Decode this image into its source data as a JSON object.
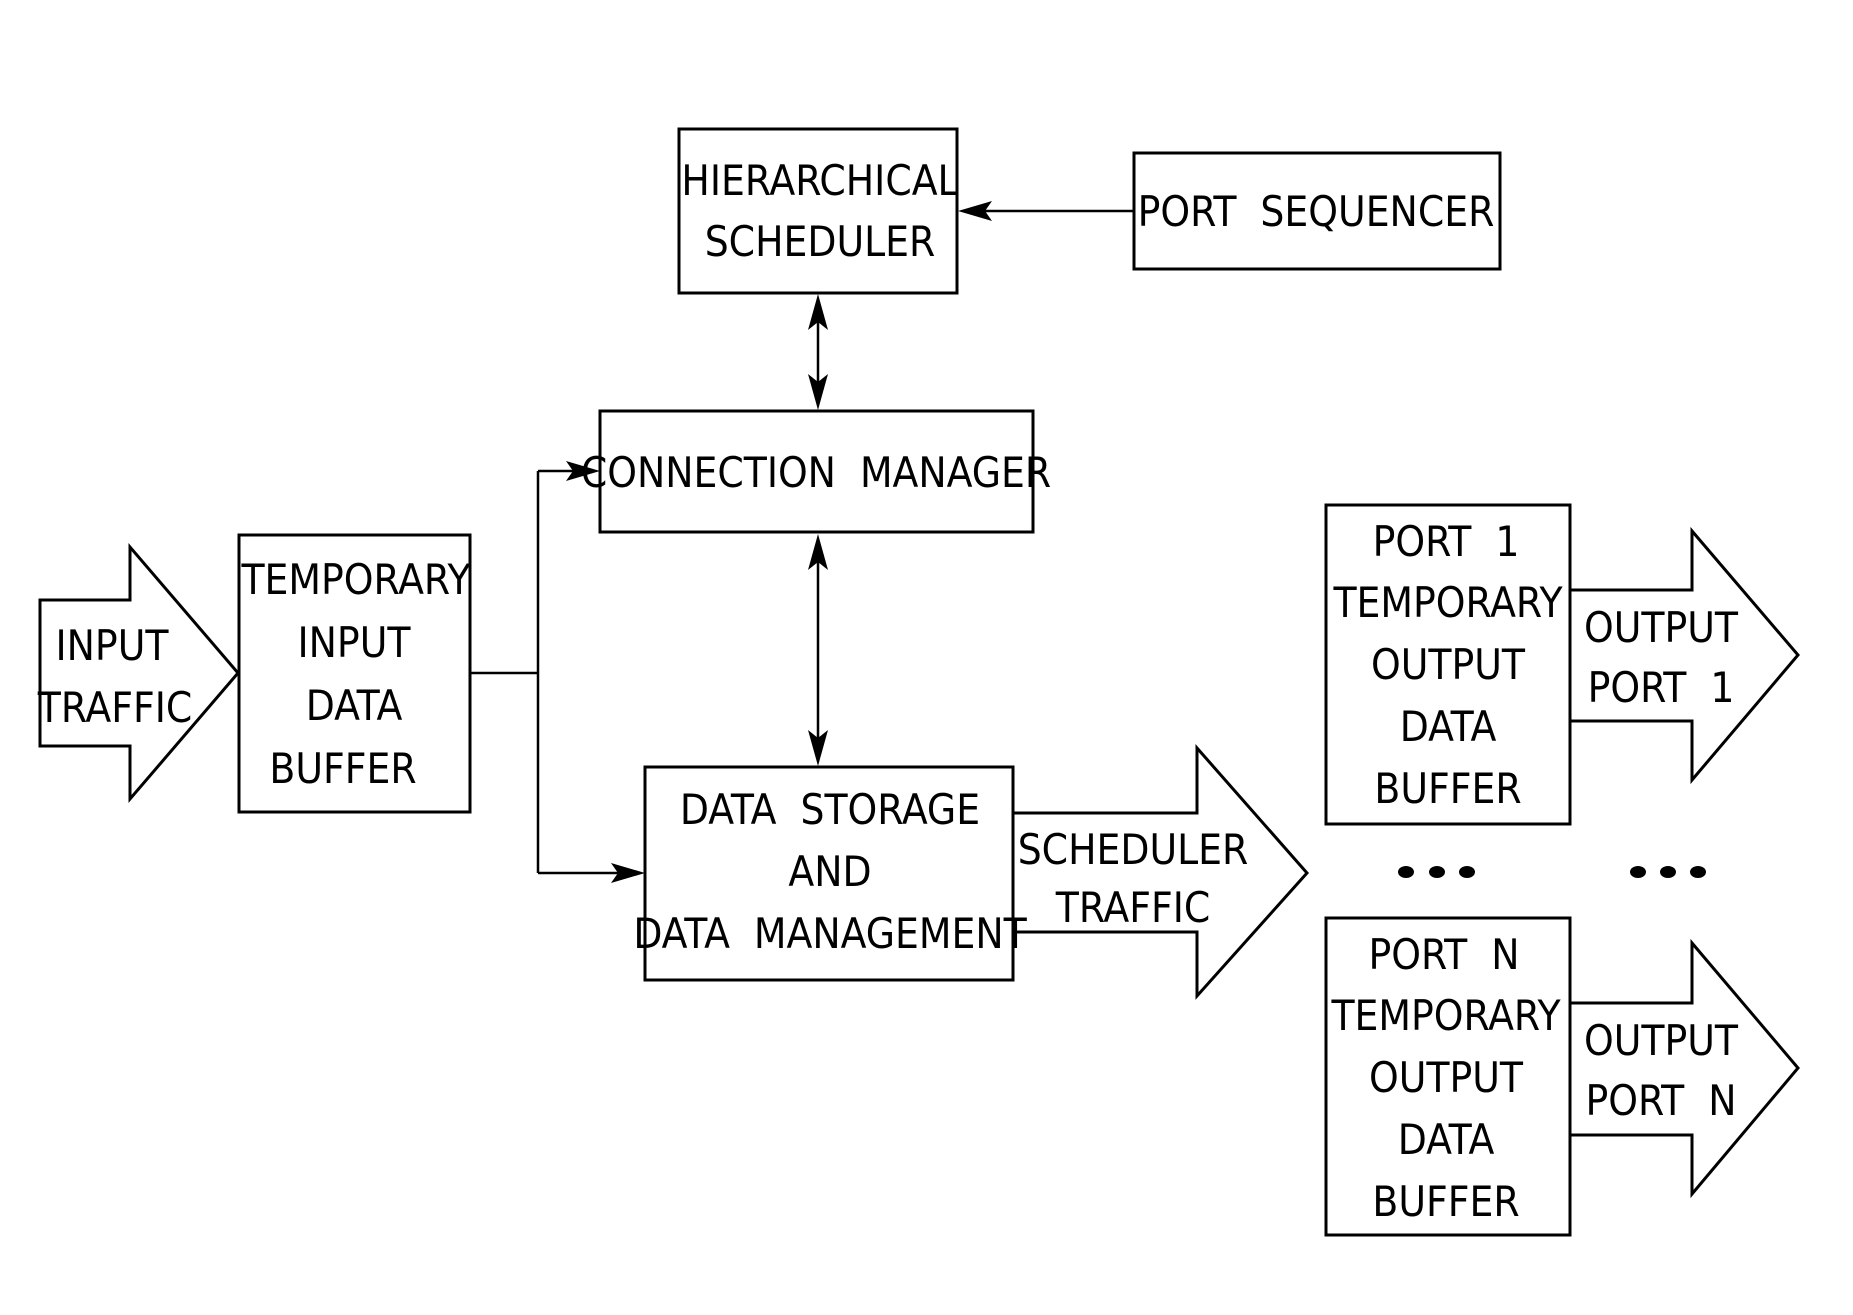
{
  "diagram": {
    "type": "block-diagram",
    "blocks": {
      "hierarchical_scheduler": {
        "lines": [
          "HIERARCHICAL",
          "SCHEDULER"
        ]
      },
      "port_sequencer": {
        "lines": [
          "PORT  SEQUENCER"
        ]
      },
      "connection_manager": {
        "lines": [
          "CONNECTION  MANAGER"
        ]
      },
      "temporary_input_data_buffer": {
        "lines": [
          "TEMPORARY",
          "INPUT",
          "DATA",
          "BUFFER"
        ]
      },
      "data_storage": {
        "lines": [
          "DATA  STORAGE",
          "AND",
          "DATA  MANAGEMENT"
        ]
      },
      "port1_buffer": {
        "lines": [
          "PORT  1",
          "TEMPORARY",
          "OUTPUT",
          "DATA",
          "BUFFER"
        ]
      },
      "portN_buffer": {
        "lines": [
          "PORT  N",
          "TEMPORARY",
          "OUTPUT",
          "DATA",
          "BUFFER"
        ]
      }
    },
    "flow_arrows": {
      "input_traffic": {
        "lines": [
          "INPUT",
          "TRAFFIC"
        ]
      },
      "scheduler_traffic": {
        "lines": [
          "SCHEDULER",
          "TRAFFIC"
        ]
      },
      "output_port1": {
        "lines": [
          "OUTPUT",
          "PORT  1"
        ]
      },
      "output_portN": {
        "lines": [
          "OUTPUT",
          "PORT  N"
        ]
      }
    },
    "ellipsis_symbol": "•••",
    "connections": [
      {
        "from": "port_sequencer",
        "to": "hierarchical_scheduler",
        "direction": "one-way"
      },
      {
        "from": "hierarchical_scheduler",
        "to": "connection_manager",
        "direction": "two-way"
      },
      {
        "from": "connection_manager",
        "to": "data_storage",
        "direction": "two-way"
      },
      {
        "from": "temporary_input_data_buffer",
        "to": "connection_manager",
        "direction": "one-way"
      },
      {
        "from": "temporary_input_data_buffer",
        "to": "data_storage",
        "direction": "one-way"
      }
    ]
  }
}
